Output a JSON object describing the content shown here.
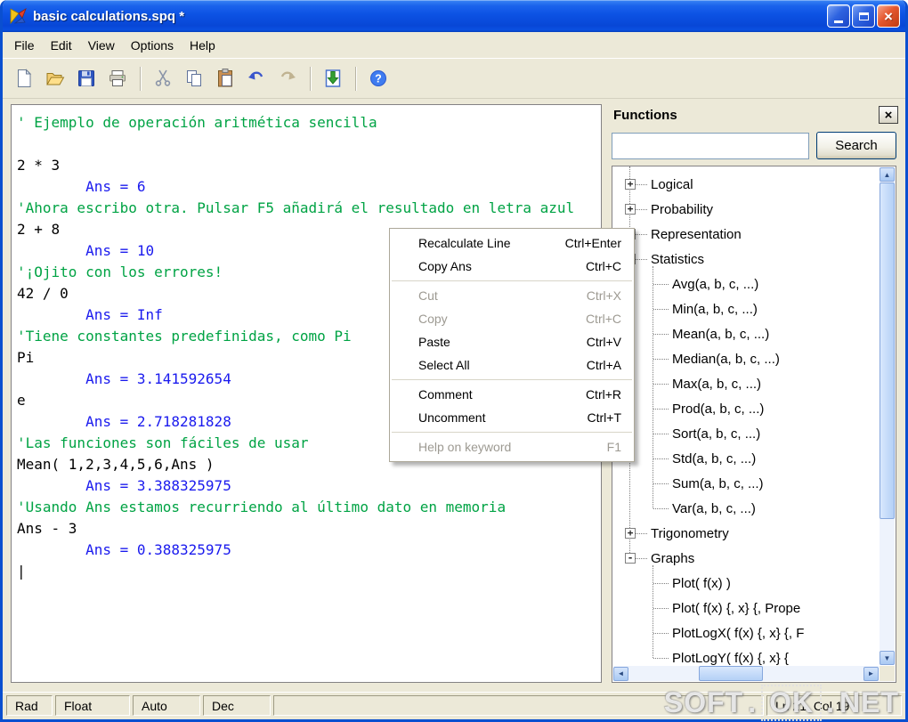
{
  "window": {
    "title": "basic calculations.spq *"
  },
  "menubar": {
    "items": [
      "File",
      "Edit",
      "View",
      "Options",
      "Help"
    ]
  },
  "toolbar": {
    "icons": [
      "new-document",
      "open-folder",
      "save",
      "print",
      "cut",
      "copy",
      "paste",
      "undo",
      "redo",
      "insert-ans",
      "help"
    ]
  },
  "editor": {
    "caret": "|",
    "lines": [
      {
        "kind": "comment",
        "text": "' Ejemplo de operación aritmética sencilla"
      },
      {
        "kind": "expr",
        "text": ""
      },
      {
        "kind": "expr",
        "text": "2 * 3"
      },
      {
        "kind": "answer",
        "text": "        Ans = 6"
      },
      {
        "kind": "comment",
        "text": "'Ahora escribo otra. Pulsar F5 añadirá el resultado en letra azul"
      },
      {
        "kind": "expr",
        "text": "2 + 8"
      },
      {
        "kind": "answer",
        "text": "        Ans = 10"
      },
      {
        "kind": "comment",
        "text": "'¡Ojito con los errores!"
      },
      {
        "kind": "expr",
        "text": "42 / 0"
      },
      {
        "kind": "answer",
        "text": "        Ans = Inf"
      },
      {
        "kind": "comment",
        "text": "'Tiene constantes predefinidas, como Pi"
      },
      {
        "kind": "expr",
        "text": "Pi"
      },
      {
        "kind": "answer",
        "text": "        Ans = 3.141592654"
      },
      {
        "kind": "expr",
        "text": "e"
      },
      {
        "kind": "answer",
        "text": "        Ans = 2.718281828"
      },
      {
        "kind": "comment",
        "text": "'Las funciones son fáciles de usar"
      },
      {
        "kind": "expr",
        "text": "Mean( 1,2,3,4,5,6,Ans )"
      },
      {
        "kind": "answer",
        "text": "        Ans = 3.388325975"
      },
      {
        "kind": "comment",
        "text": "'Usando Ans estamos recurriendo al último dato en memoria"
      },
      {
        "kind": "expr",
        "text": "Ans - 3"
      },
      {
        "kind": "answer",
        "text": "        Ans = 0.388325975"
      }
    ]
  },
  "context_menu": {
    "items": [
      {
        "label": "Recalculate Line",
        "shortcut": "Ctrl+Enter",
        "state": "enabled"
      },
      {
        "label": "Copy Ans",
        "shortcut": "Ctrl+C",
        "state": "enabled"
      },
      {
        "label": "Cut",
        "shortcut": "Ctrl+X",
        "state": "disabled"
      },
      {
        "label": "Copy",
        "shortcut": "Ctrl+C",
        "state": "disabled"
      },
      {
        "label": "Paste",
        "shortcut": "Ctrl+V",
        "state": "enabled"
      },
      {
        "label": "Select All",
        "shortcut": "Ctrl+A",
        "state": "enabled"
      },
      {
        "label": "Comment",
        "shortcut": "Ctrl+R",
        "state": "enabled"
      },
      {
        "label": "Uncomment",
        "shortcut": "Ctrl+T",
        "state": "enabled"
      },
      {
        "label": "Help on keyword",
        "shortcut": "F1",
        "state": "disabled"
      }
    ]
  },
  "functions_panel": {
    "title": "Functions",
    "close_icon": "×",
    "search_value": "",
    "search_button": "Search",
    "scroll_icons": {
      "up": "▲",
      "down": "▼",
      "left": "◄",
      "right": "►"
    },
    "tree": [
      {
        "label": "Logical",
        "level": 0,
        "expander": "+"
      },
      {
        "label": "Probability",
        "level": 0,
        "expander": "+"
      },
      {
        "label": "Representation",
        "level": 0,
        "expander": "+"
      },
      {
        "label": "Statistics",
        "level": 0,
        "expander": "-"
      },
      {
        "label": "Avg(a, b, c, ...)",
        "level": 1
      },
      {
        "label": "Min(a, b, c, ...)",
        "level": 1
      },
      {
        "label": "Mean(a, b, c, ...)",
        "level": 1
      },
      {
        "label": "Median(a, b, c, ...)",
        "level": 1
      },
      {
        "label": "Max(a, b, c, ...)",
        "level": 1
      },
      {
        "label": "Prod(a, b, c, ...)",
        "level": 1
      },
      {
        "label": "Sort(a, b, c, ...)",
        "level": 1
      },
      {
        "label": "Std(a, b, c, ...)",
        "level": 1
      },
      {
        "label": "Sum(a, b, c, ...)",
        "level": 1
      },
      {
        "label": "Var(a, b, c, ...)",
        "level": 1
      },
      {
        "label": "Trigonometry",
        "level": 0,
        "expander": "+"
      },
      {
        "label": "Graphs",
        "level": 0,
        "expander": "-"
      },
      {
        "label": "Plot( f(x) )",
        "level": 1
      },
      {
        "label": "Plot( f(x) {, x} {, Prope",
        "level": 1
      },
      {
        "label": "PlotLogX( f(x) {, x} {, F",
        "level": 1
      },
      {
        "label": "PlotLogY( f(x) {, x} {",
        "level": 1
      }
    ]
  },
  "statusbar": {
    "panels": [
      "Rad",
      "Float",
      "Auto",
      "Dec"
    ],
    "position": "Ln 21, Col 19"
  },
  "watermark": {
    "soft": "SOFT",
    "dot1": ".",
    "ok": "OK",
    "dot2": ".",
    "net": "NET"
  },
  "colors": {
    "titlebar_blue": "#0c52e4",
    "window_border": "#0a4fd0",
    "chrome_beige": "#ece9d8",
    "comment_green": "#00a344",
    "answer_blue": "#1a1aee",
    "close_red": "#d8452c"
  }
}
